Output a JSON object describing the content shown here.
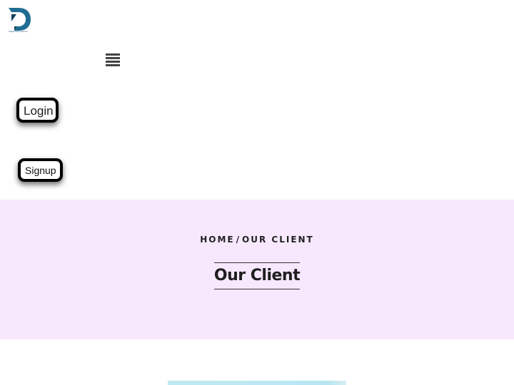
{
  "header": {
    "logo": {
      "letter": "D",
      "tagline": "Digital Web Solution",
      "icon": "logo-d-icon",
      "colors": {
        "primary": "#1f6d93",
        "secondary": "#0d3f5e"
      }
    },
    "menu_toggle_icon": "hamburger-menu-icon",
    "login_label": "Login",
    "signup_label": "Signup"
  },
  "banner": {
    "background": "#f7e8fd",
    "breadcrumb": {
      "home": "HOME",
      "separator": "/",
      "current": "OUR CLIENT"
    },
    "title": "Our Client"
  }
}
